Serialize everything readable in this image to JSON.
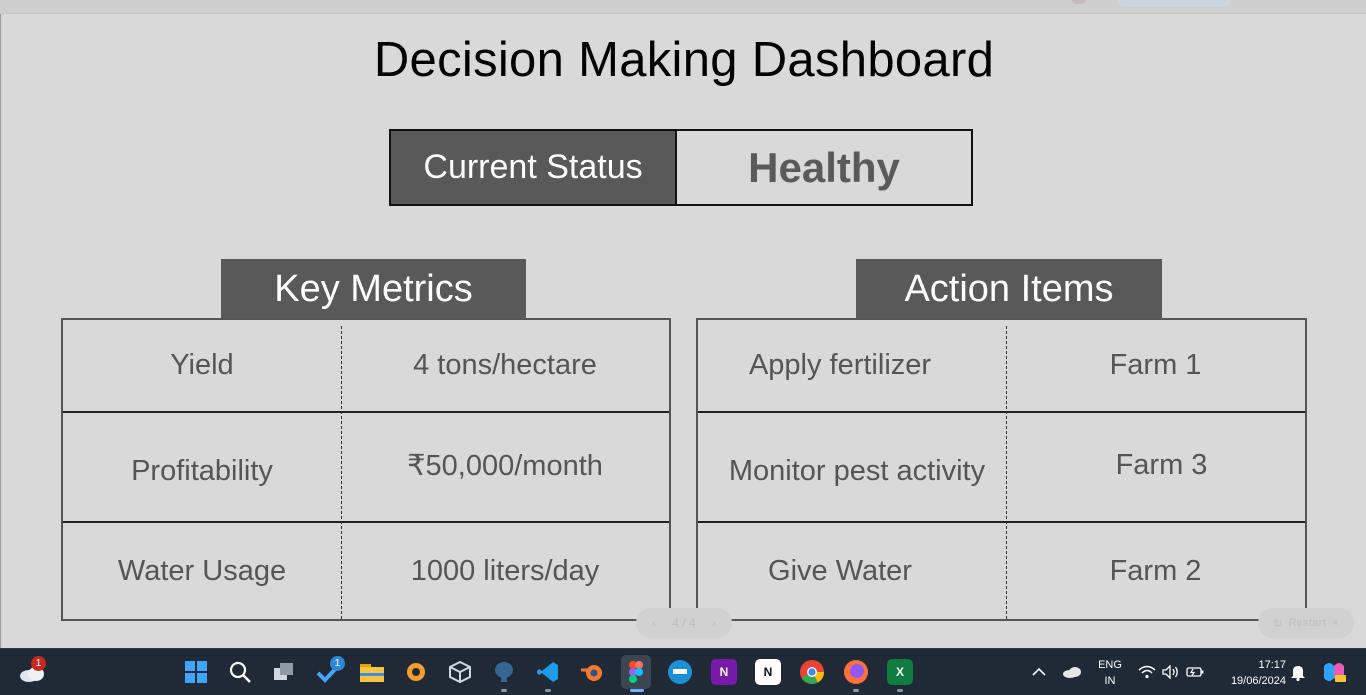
{
  "slide": {
    "title": "Decision Making Dashboard",
    "status_label": "Current Status",
    "status_value": "Healthy",
    "key_metrics": {
      "heading": "Key Metrics",
      "rows": [
        {
          "name": "Yield",
          "value": "4 tons/hectare"
        },
        {
          "name": "Profitability",
          "value": "₹50,000/month"
        },
        {
          "name": "Water Usage",
          "value": "1000 liters/day"
        }
      ]
    },
    "action_items": {
      "heading": "Action Items",
      "rows": [
        {
          "action": "Apply fertilizer",
          "target": "Farm 1"
        },
        {
          "action": "Monitor pest activity",
          "target": "Farm 3"
        },
        {
          "action": "Give Water",
          "target": "Farm 2"
        }
      ]
    }
  },
  "presenter": {
    "pager": "4 / 4",
    "restart_label": "Restart"
  },
  "taskbar": {
    "weather_badge": "1",
    "todo_badge": "1",
    "apps": [
      "start",
      "search",
      "task-view",
      "todo",
      "file-explorer",
      "app-gear",
      "virtualbox",
      "pgadmin",
      "vscode",
      "blender",
      "figma",
      "docker",
      "onenote",
      "notion",
      "chrome",
      "firefox",
      "excel"
    ],
    "language": "ENG",
    "region": "IN",
    "time": "17:17",
    "date": "19/06/2024"
  },
  "colors": {
    "panel_dark": "#595959",
    "slide_bg": "#d9d9d9",
    "taskbar_bg": "#1f2a36"
  }
}
